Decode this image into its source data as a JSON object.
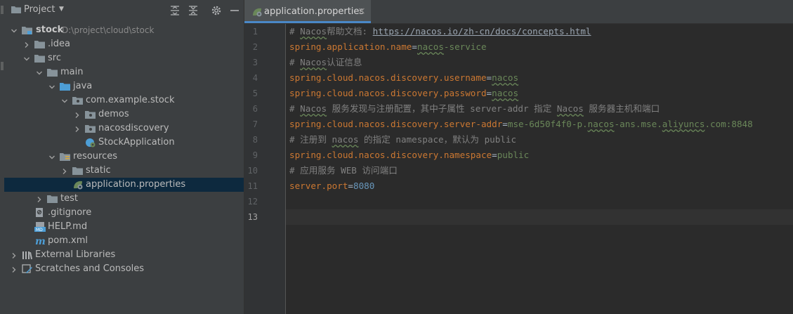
{
  "project_panel": {
    "title": "Project",
    "caret_icon": "dropdown-caret-icon",
    "header_icons": [
      "expand-all-icon",
      "collapse-all-icon",
      "gear-icon",
      "minimize-icon"
    ]
  },
  "tree": {
    "root": {
      "label": "stock",
      "path": "D:\\project\\cloud\\stock"
    },
    "idea": ".idea",
    "src": "src",
    "main": "main",
    "java": "java",
    "package": "com.example.stock",
    "demos": "demos",
    "nacosdiscovery": "nacosdiscovery",
    "stock_app": "StockApplication",
    "resources": "resources",
    "static": "static",
    "app_props": "application.properties",
    "test": "test",
    "gitignore": ".gitignore",
    "help": "HELP.md",
    "pom": "pom.xml",
    "ext_libs": "External Libraries",
    "scratches": "Scratches and Consoles"
  },
  "editor": {
    "tab_label": "application.properties",
    "tab_close": "×",
    "line_numbers": [
      "1",
      "2",
      "3",
      "4",
      "5",
      "6",
      "7",
      "8",
      "9",
      "10",
      "11",
      "12",
      "13"
    ],
    "current_line": "13",
    "lines": {
      "l1_prefix": "# ",
      "l1_nacos": "Nacos",
      "l1_text": "帮助文档: ",
      "l1_url": "https://nacos.io/zh-cn/docs/concepts.html",
      "l2_key": "spring.application.name",
      "l2_eq": "=",
      "l2_val1": "nacos",
      "l2_val2": "-service",
      "l3_prefix": "# ",
      "l3_nacos": "Nacos",
      "l3_text": "认证信息",
      "l4_key": "spring.cloud.nacos.discovery.username",
      "l4_eq": "=",
      "l4_val": "nacos",
      "l5_key": "spring.cloud.nacos.discovery.password",
      "l5_eq": "=",
      "l5_val": "nacos",
      "l6_prefix": "# ",
      "l6_nacos1": "Nacos",
      "l6_mid": " 服务发现与注册配置，其中子属性 server-addr 指定 ",
      "l6_nacos2": "Nacos",
      "l6_end": " 服务器主机和端口",
      "l7_key": "spring.cloud.nacos.discovery.server-addr",
      "l7_eq": "=",
      "l7_val1": "mse-6d50f4f0-p.",
      "l7_val2": "nacos",
      "l7_val3": "-ans.mse.",
      "l7_val4": "aliyuncs",
      "l7_val5": ".com:8848",
      "l8_prefix": "# 注册到 ",
      "l8_nacos": "nacos",
      "l8_end": " 的指定 namespace，默认为 public",
      "l9_key": "spring.cloud.nacos.discovery.namespace",
      "l9_eq": "=",
      "l9_val": "public",
      "l10": "# 应用服务 WEB 访问端口",
      "l11_key": "server.port",
      "l11_eq": "=",
      "l11_val": "8080"
    }
  },
  "colors": {
    "background": "#2b2b2b",
    "panel": "#3c3f41",
    "selection": "#0d293e",
    "keyword": "#cc7832",
    "string": "#6a8759",
    "number": "#6897bb",
    "comment": "#808080",
    "folder": "#87939a",
    "source_folder": "#4d9ed6"
  }
}
